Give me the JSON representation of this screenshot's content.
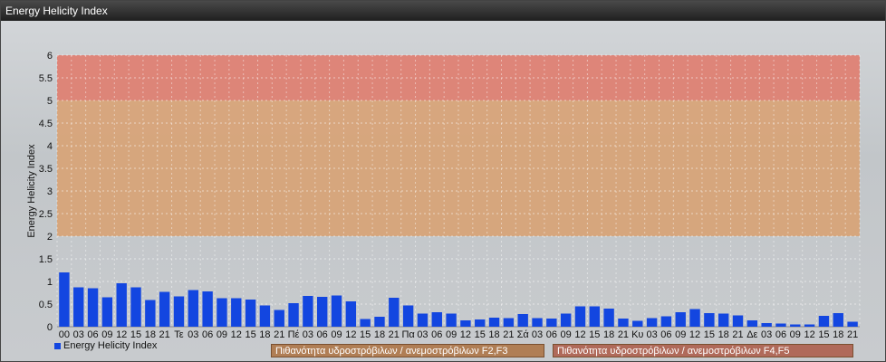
{
  "window": {
    "title": "Energy Helicity Index"
  },
  "legend": {
    "series_label": "Energy Helicity Index",
    "band1_label": "Πιθανότητα υδροστρόβιλων / ανεμοστρόβιλων F2,F3",
    "band2_label": "Πιθανότητα υδροστρόβιλων / ανεμοστρόβιλων F4,F5"
  },
  "colors": {
    "bar": "#1346e0",
    "band_low": "#d9a070",
    "band_high": "#e07868",
    "band1_box": "#b07e55",
    "band2_box": "#b06a5a"
  },
  "chart_data": {
    "type": "bar",
    "ylabel": "Energy Helicity Index",
    "ylim": [
      0,
      6
    ],
    "yticks": [
      "0",
      "0.5",
      "1",
      "1.5",
      "2",
      "2.5",
      "3",
      "3.5",
      "4",
      "4.5",
      "5",
      "5.5",
      "6"
    ],
    "grid": true,
    "bands": [
      {
        "from": 2,
        "to": 5,
        "label": "Πιθανότητα υδροστρόβιλων / ανεμοστρόβιλων F2,F3"
      },
      {
        "from": 5,
        "to": 6,
        "label": "Πιθανότητα υδροστρόβιλων / ανεμοστρόβιλων F4,F5"
      }
    ],
    "categories": [
      "00",
      "03",
      "06",
      "09",
      "12",
      "15",
      "18",
      "21",
      "Τε",
      "03",
      "06",
      "09",
      "12",
      "15",
      "18",
      "21",
      "Πέ",
      "03",
      "06",
      "09",
      "12",
      "15",
      "18",
      "21",
      "Πα",
      "03",
      "06",
      "09",
      "12",
      "15",
      "18",
      "21",
      "Σά",
      "03",
      "06",
      "09",
      "12",
      "15",
      "18",
      "21",
      "Κυ",
      "03",
      "06",
      "09",
      "12",
      "15",
      "18",
      "21",
      "Δε",
      "03",
      "06",
      "09",
      "12",
      "15",
      "18",
      "21"
    ],
    "series": [
      {
        "name": "Energy Helicity Index",
        "values": [
          1.2,
          0.87,
          0.85,
          0.65,
          0.96,
          0.87,
          0.59,
          0.77,
          0.67,
          0.81,
          0.78,
          0.63,
          0.63,
          0.6,
          0.47,
          0.37,
          0.52,
          0.68,
          0.66,
          0.69,
          0.56,
          0.17,
          0.22,
          0.64,
          0.47,
          0.29,
          0.32,
          0.29,
          0.14,
          0.16,
          0.2,
          0.19,
          0.28,
          0.19,
          0.18,
          0.29,
          0.45,
          0.45,
          0.4,
          0.18,
          0.13,
          0.19,
          0.23,
          0.32,
          0.39,
          0.3,
          0.29,
          0.25,
          0.14,
          0.08,
          0.07,
          0.05,
          0.05,
          0.24,
          0.3,
          0.11
        ]
      }
    ]
  }
}
